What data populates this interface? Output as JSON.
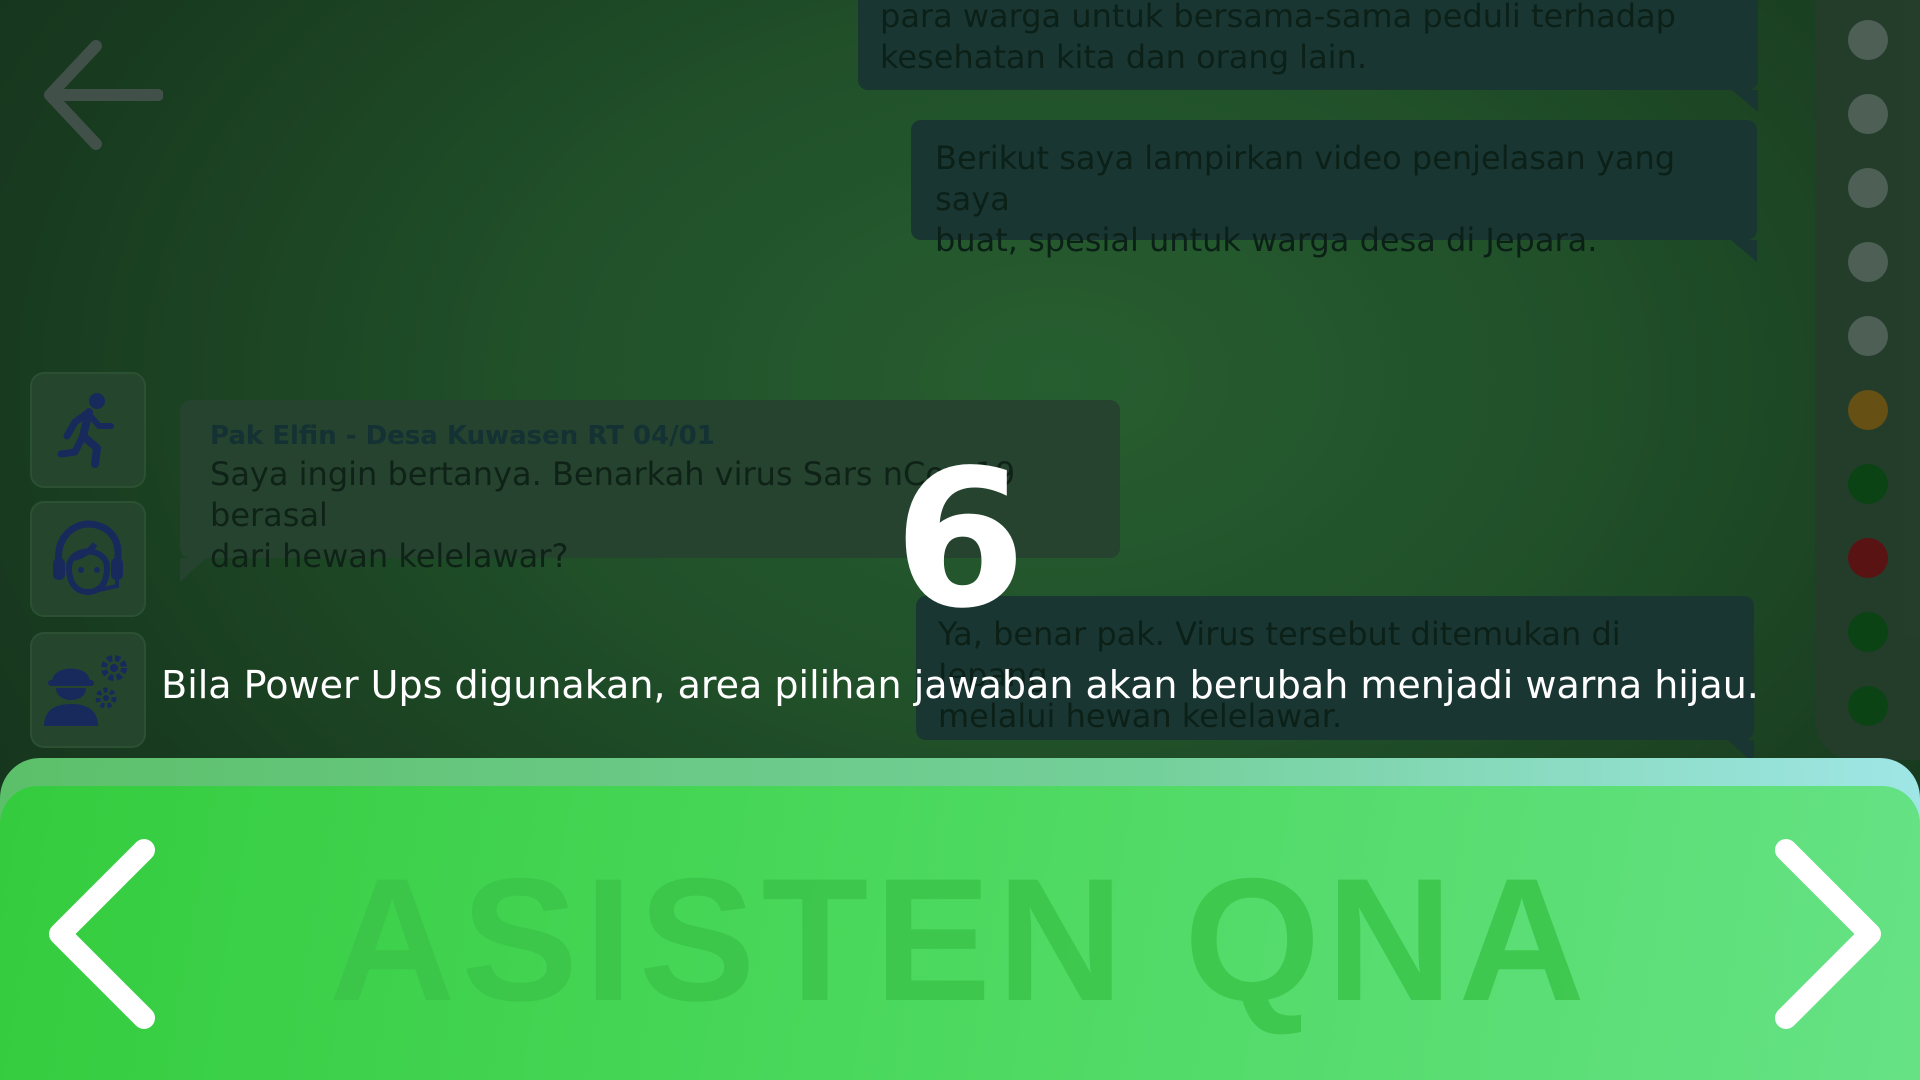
{
  "chat": {
    "messages": [
      {
        "side": "right",
        "lines": [
          "para warga untuk bersama-sama peduli terhadap",
          "kesehatan kita dan orang lain."
        ]
      },
      {
        "side": "right",
        "lines": [
          "Berikut saya lampirkan video penjelasan yang saya",
          "buat, spesial untuk warga desa di Jepara."
        ]
      },
      {
        "side": "left",
        "sender": "Pak Elfin - Desa Kuwasen RT 04/01",
        "lines": [
          "Saya ingin bertanya. Benarkah virus Sars nCov-19 berasal",
          "dari hewan kelelawar?"
        ]
      },
      {
        "side": "right",
        "lines": [
          "Ya, benar pak. Virus tersebut ditemukan di Jepang",
          "melalui hewan kelelawar."
        ]
      }
    ]
  },
  "powerups": [
    {
      "icon": "running-person-icon"
    },
    {
      "icon": "headset-agent-icon"
    },
    {
      "icon": "engineer-gear-icon"
    }
  ],
  "progress": {
    "dots": [
      "#5d6d63",
      "#5d6d63",
      "#5d6d63",
      "#5d6d63",
      "#5d6d63",
      "#7a5a14",
      "#0b4a14",
      "#6a0f12",
      "#0b4a14",
      "#0b4a14"
    ]
  },
  "overlay": {
    "countdown": "6",
    "hint": "Bila Power Ups digunakan, area pilihan jawaban akan berubah menjadi warna hijau."
  },
  "banner": {
    "title": "ASISTEN QNA"
  },
  "icons": {
    "back": "back-arrow-icon",
    "prev": "chevron-left-icon",
    "next": "chevron-right-icon"
  }
}
